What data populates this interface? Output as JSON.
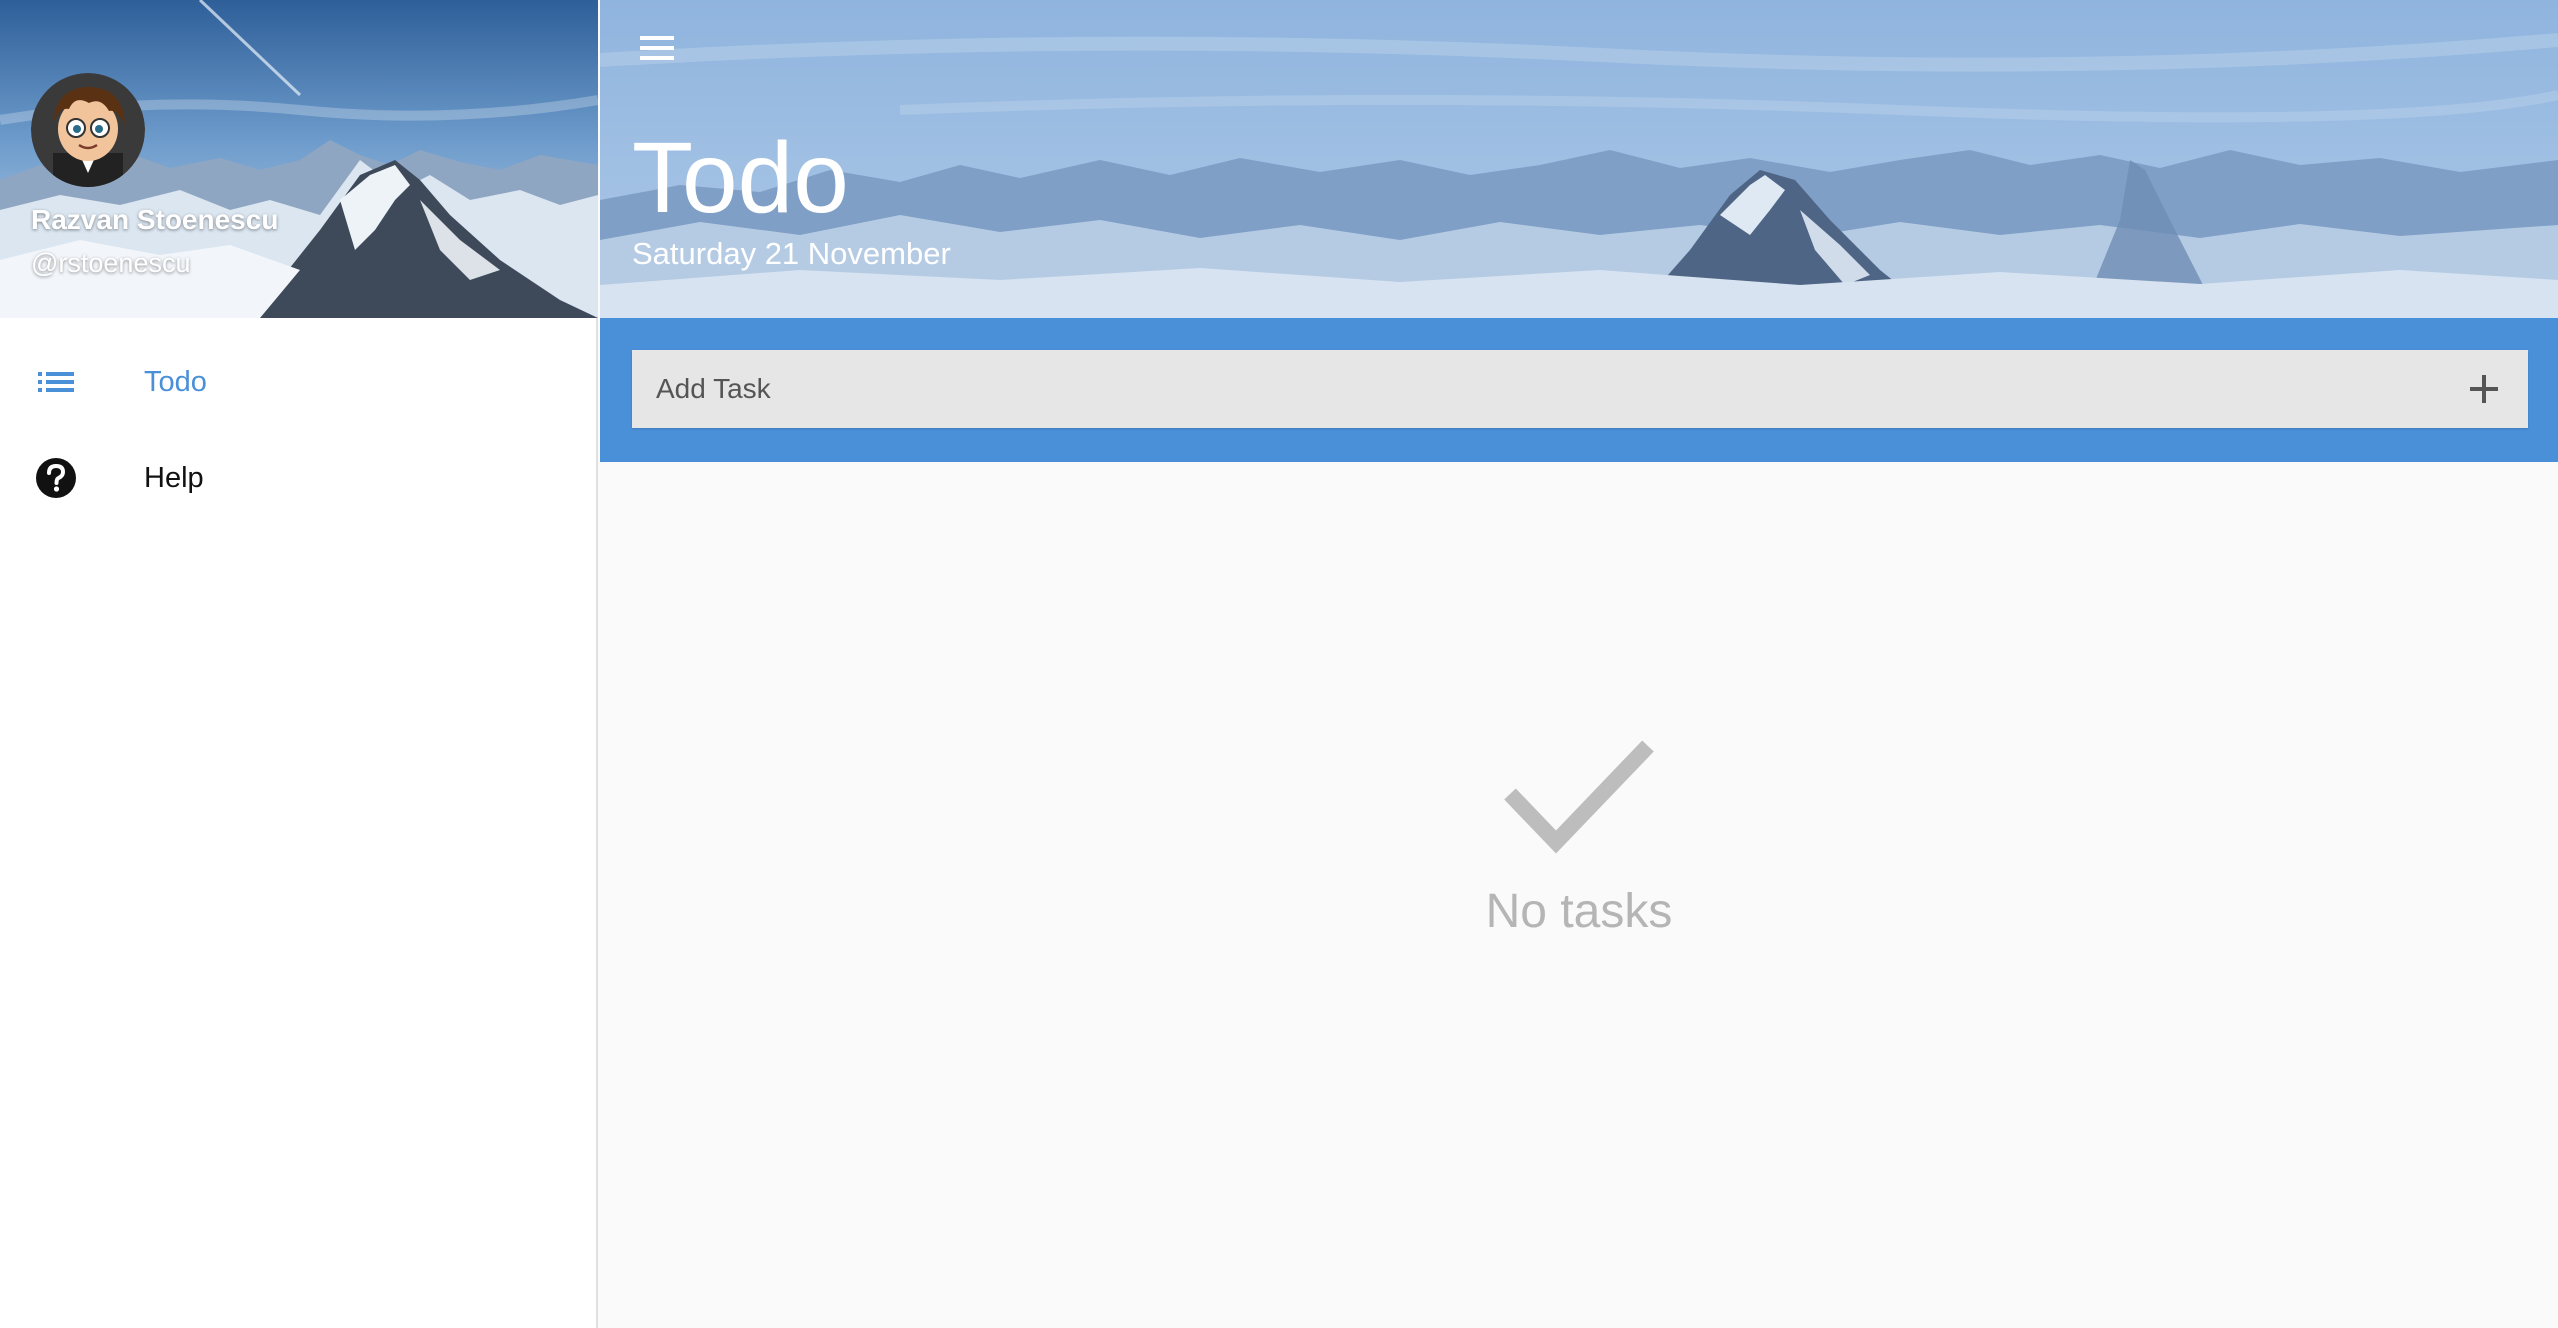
{
  "user": {
    "name": "Razvan Stoenescu",
    "handle": "@rstoenescu"
  },
  "nav": {
    "items": [
      {
        "label": "Todo",
        "icon": "list-icon",
        "active": true
      },
      {
        "label": "Help",
        "icon": "help-icon",
        "active": false
      }
    ]
  },
  "header": {
    "title": "Todo",
    "date": "Saturday 21 November",
    "menu_icon": "menu-icon"
  },
  "add_task": {
    "placeholder": "Add Task",
    "value": "",
    "add_icon": "plus-icon"
  },
  "empty_state": {
    "icon": "check-icon",
    "label": "No tasks"
  },
  "colors": {
    "accent": "#4a90d9",
    "active_nav": "#4a90d9",
    "empty_text": "#b5b5b5",
    "input_bg": "#e6e6e6"
  }
}
